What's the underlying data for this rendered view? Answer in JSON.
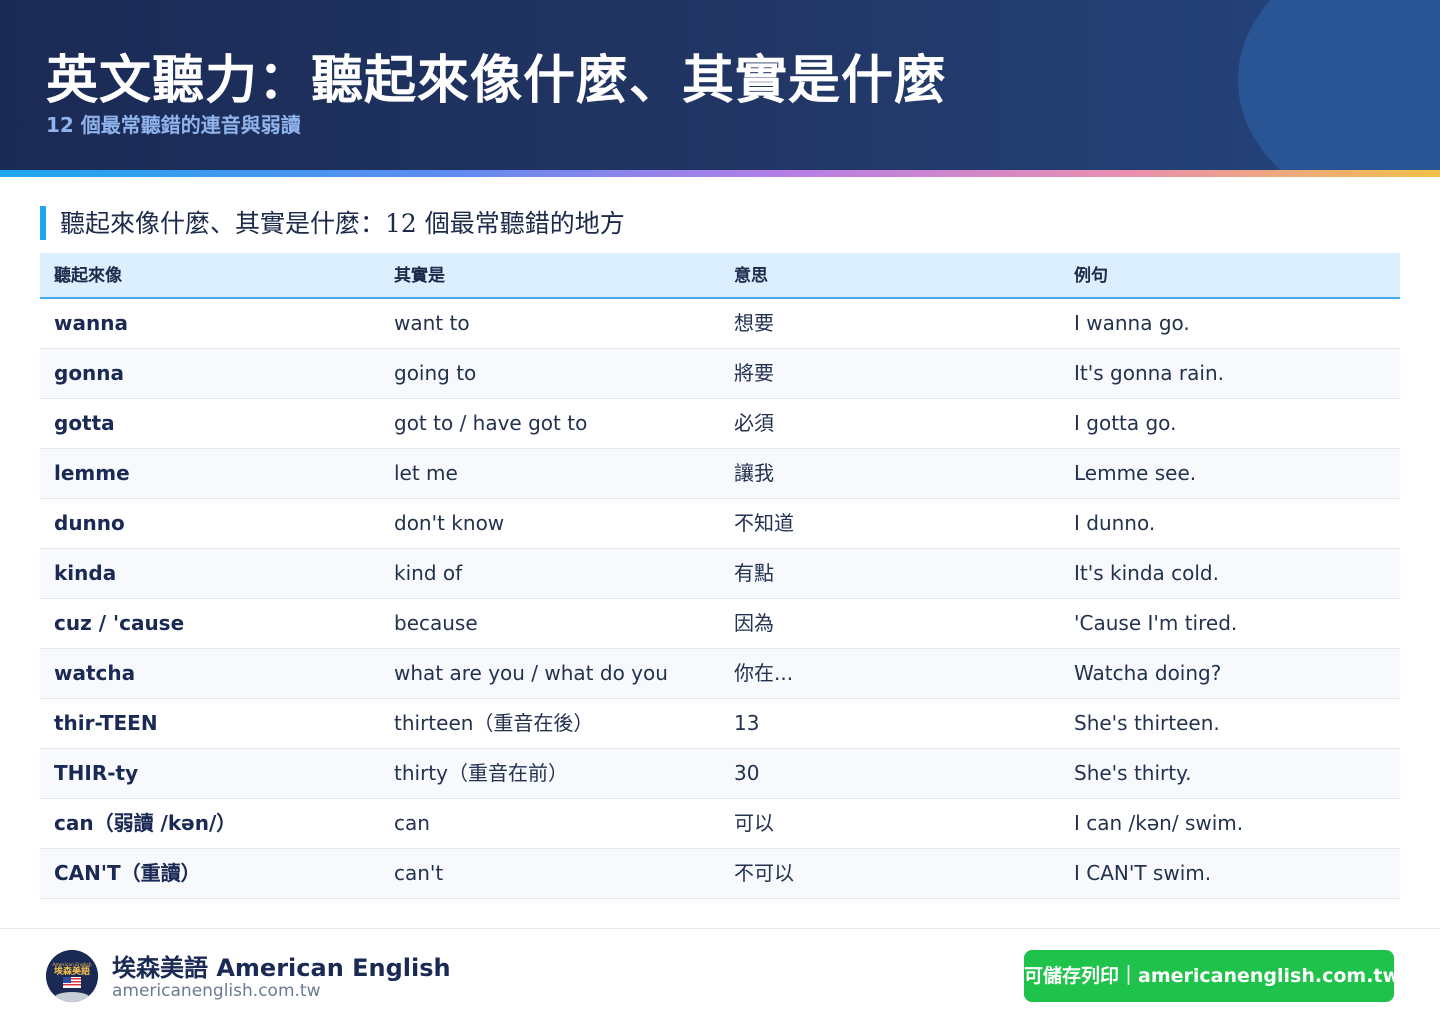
{
  "header": {
    "title": "英文聽力：聽起來像什麼、其實是什麼",
    "subtitle": "12 個最常聽錯的連音與弱讀"
  },
  "section_title": "聽起來像什麼、其實是什麼：12 個最常聽錯的地方",
  "table": {
    "headers": [
      "聽起來像",
      "其實是",
      "意思",
      "例句"
    ],
    "rows": [
      [
        "wanna",
        "want to",
        "想要",
        "I wanna go."
      ],
      [
        "gonna",
        "going to",
        "將要",
        "It's gonna rain."
      ],
      [
        "gotta",
        "got to / have got to",
        "必須",
        "I gotta go."
      ],
      [
        "lemme",
        "let me",
        "讓我",
        "Lemme see."
      ],
      [
        "dunno",
        "don't know",
        "不知道",
        "I dunno."
      ],
      [
        "kinda",
        "kind of",
        "有點",
        "It's kinda cold."
      ],
      [
        "cuz / 'cause",
        "because",
        "因為",
        "'Cause I'm tired."
      ],
      [
        "watcha",
        "what are you / what do you",
        "你在...",
        "Watcha doing?"
      ],
      [
        "thir-TEEN",
        "thirteen（重音在後）",
        "13",
        "She's thirteen."
      ],
      [
        "THIR-ty",
        "thirty（重音在前）",
        "30",
        "She's thirty."
      ],
      [
        "can（弱讀 /kən/）",
        "can",
        "可以",
        "I can /kən/ swim."
      ],
      [
        "CAN'T（重讀）",
        "can't",
        "不可以",
        "I CAN'T swim."
      ]
    ]
  },
  "footer": {
    "logo_top_text": "American English",
    "logo_text": "埃森美語",
    "brand": "埃森美語 American English",
    "site": "americanenglish.com.tw",
    "print_button": "可儲存列印｜americanenglish.com.tw"
  }
}
